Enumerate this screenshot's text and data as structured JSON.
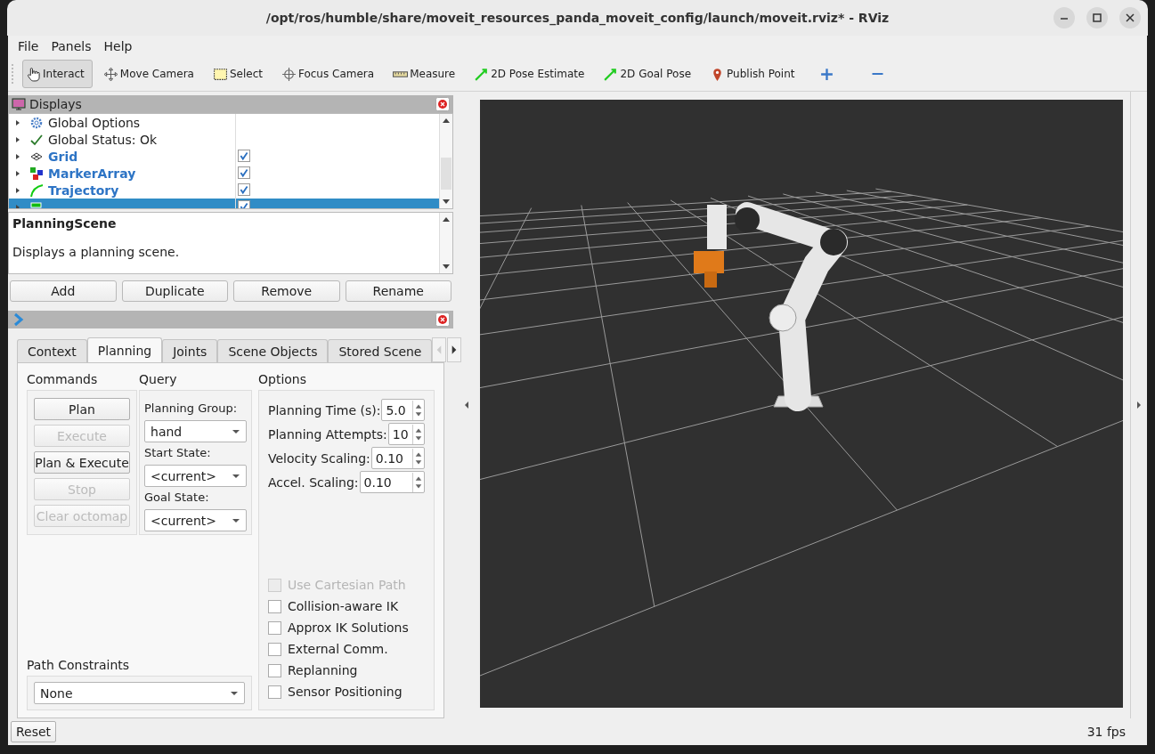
{
  "window": {
    "title": "/opt/ros/humble/share/moveit_resources_panda_moveit_config/launch/moveit.rviz* - RViz"
  },
  "menu": [
    {
      "label": "File"
    },
    {
      "label": "Panels"
    },
    {
      "label": "Help"
    }
  ],
  "toolbar": [
    {
      "kind": "interact",
      "label": "Interact",
      "selected": true
    },
    {
      "kind": "move",
      "label": "Move Camera",
      "selected": false
    },
    {
      "kind": "select",
      "label": "Select",
      "selected": false
    },
    {
      "kind": "focus",
      "label": "Focus Camera",
      "selected": false
    },
    {
      "kind": "measure",
      "label": "Measure",
      "selected": false
    },
    {
      "kind": "pose",
      "label": "2D Pose Estimate",
      "selected": false
    },
    {
      "kind": "pose",
      "label": "2D Goal Pose",
      "selected": false
    },
    {
      "kind": "point",
      "label": "Publish Point",
      "selected": false
    },
    {
      "kind": "add",
      "selected": false
    },
    {
      "kind": "remove",
      "selected": false
    }
  ],
  "displays": {
    "title": "Displays",
    "items": [
      {
        "kind": "options",
        "label": "Global Options",
        "selected": false
      },
      {
        "kind": "status",
        "label": "Global Status: Ok",
        "selected": false
      },
      {
        "kind": "grid",
        "label": "Grid",
        "checked": true,
        "selected": false
      },
      {
        "kind": "marker",
        "label": "MarkerArray",
        "checked": true,
        "selected": false
      },
      {
        "kind": "trajectory",
        "label": "Trajectory",
        "checked": true,
        "selected": false
      },
      {
        "kind": "scene",
        "checked": true,
        "selected": true
      }
    ],
    "description": {
      "title": "PlanningScene",
      "text": "Displays a planning scene."
    },
    "buttons": [
      "Add",
      "Duplicate",
      "Remove",
      "Rename"
    ]
  },
  "motion_planning": {
    "tabs": [
      {
        "label": "Context",
        "selected": false
      },
      {
        "label": "Planning",
        "selected": true
      },
      {
        "label": "Joints",
        "selected": false
      },
      {
        "label": "Scene Objects",
        "selected": false
      },
      {
        "label": "Stored Scene",
        "selected": false
      }
    ],
    "commands": {
      "title": "Commands",
      "buttons": [
        {
          "label": "Plan",
          "disabled": false
        },
        {
          "label": "Execute",
          "disabled": true
        },
        {
          "label": "Plan & Execute",
          "disabled": false
        },
        {
          "label": "Stop",
          "disabled": true
        },
        {
          "label": "Clear octomap",
          "disabled": true
        }
      ]
    },
    "query": {
      "title": "Query",
      "fields": [
        {
          "label": "Planning Group:",
          "value": "hand"
        },
        {
          "label": "Start State:",
          "value": "<current>"
        },
        {
          "label": "Goal State:",
          "value": "<current>"
        }
      ]
    },
    "options": {
      "title": "Options",
      "spinners": [
        {
          "label": "Planning Time (s):",
          "value": "5.0"
        },
        {
          "label": "Planning Attempts:",
          "value": "10"
        },
        {
          "label": "Velocity Scaling:",
          "value": "0.10"
        },
        {
          "label": "Accel. Scaling:",
          "value": "0.10"
        }
      ],
      "checkboxes": [
        {
          "label": "Use Cartesian Path",
          "checked": false,
          "disabled": true
        },
        {
          "label": "Collision-aware IK",
          "checked": false,
          "disabled": false
        },
        {
          "label": "Approx IK Solutions",
          "checked": false,
          "disabled": false
        },
        {
          "label": "External Comm.",
          "checked": false,
          "disabled": false
        },
        {
          "label": "Replanning",
          "checked": false,
          "disabled": false
        },
        {
          "label": "Sensor Positioning",
          "checked": false,
          "disabled": false
        }
      ]
    },
    "path_constraints": {
      "title": "Path Constraints",
      "value": "None"
    }
  },
  "reset_button": "Reset",
  "status": "31 fps"
}
